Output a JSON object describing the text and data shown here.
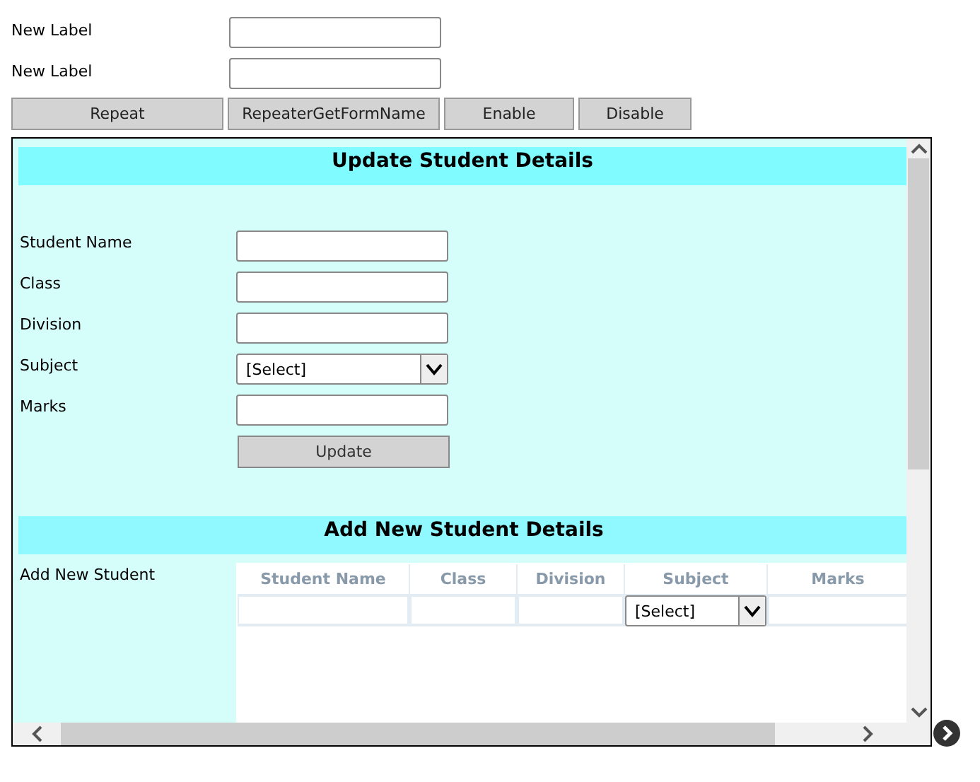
{
  "top_fields": [
    {
      "label": "New Label"
    },
    {
      "label": "New Label"
    }
  ],
  "buttons": [
    "Repeat",
    "RepeaterGetFormName",
    "Enable",
    "Disable"
  ],
  "update_section": {
    "title": "Update Student Details",
    "fields": [
      {
        "label": "Student Name",
        "kind": "text"
      },
      {
        "label": "Class",
        "kind": "text"
      },
      {
        "label": "Division",
        "kind": "text"
      },
      {
        "label": "Subject",
        "kind": "select",
        "value": "[Select]"
      },
      {
        "label": "Marks",
        "kind": "text"
      }
    ],
    "button": "Update"
  },
  "add_section": {
    "title": "Add New Student Details",
    "label": "Add New Student",
    "columns": [
      "Student Name",
      "Class",
      "Division",
      "Subject",
      "Marks"
    ],
    "row": [
      {
        "kind": "text"
      },
      {
        "kind": "text"
      },
      {
        "kind": "text"
      },
      {
        "kind": "select",
        "value": "[Select]"
      },
      {
        "kind": "text"
      }
    ]
  }
}
